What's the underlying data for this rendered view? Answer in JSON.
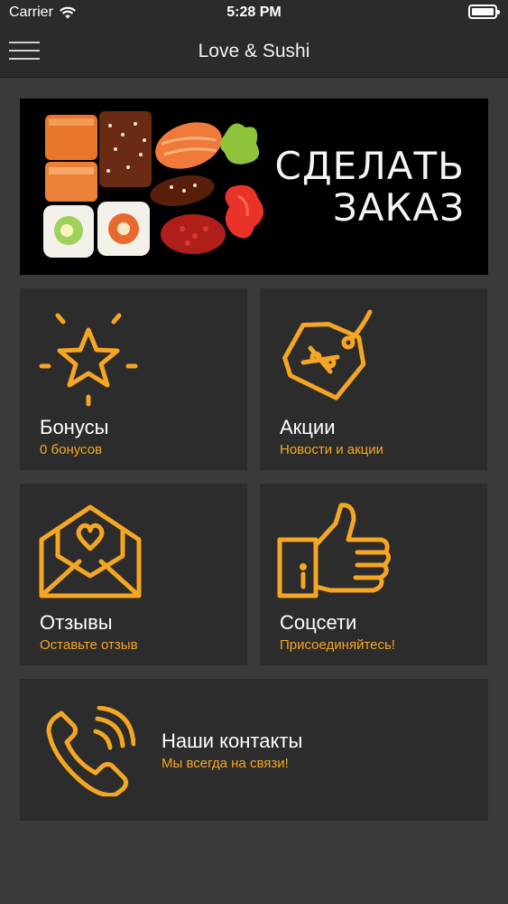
{
  "status_bar": {
    "carrier": "Carrier",
    "time": "5:28 PM"
  },
  "nav": {
    "title": "Love & Sushi"
  },
  "banner": {
    "line1": "СДЕЛАТЬ",
    "line2": "ЗАКАЗ"
  },
  "tiles": [
    {
      "title": "Бонусы",
      "subtitle": "0 бонусов",
      "icon": "star-icon"
    },
    {
      "title": "Акции",
      "subtitle": "Новости и акции",
      "icon": "discount-tag-icon"
    },
    {
      "title": "Отзывы",
      "subtitle": "Оставьте отзыв",
      "icon": "envelope-heart-icon"
    },
    {
      "title": "Соцсети",
      "subtitle": "Присоединяйтесь!",
      "icon": "thumbs-up-icon"
    },
    {
      "title": "Наши контакты",
      "subtitle": "Мы всегда на связи!",
      "icon": "phone-icon"
    }
  ],
  "colors": {
    "accent": "#f5a623",
    "background": "#3a3a3a",
    "tile": "#2c2c2c",
    "bar": "#2b2b2b"
  }
}
